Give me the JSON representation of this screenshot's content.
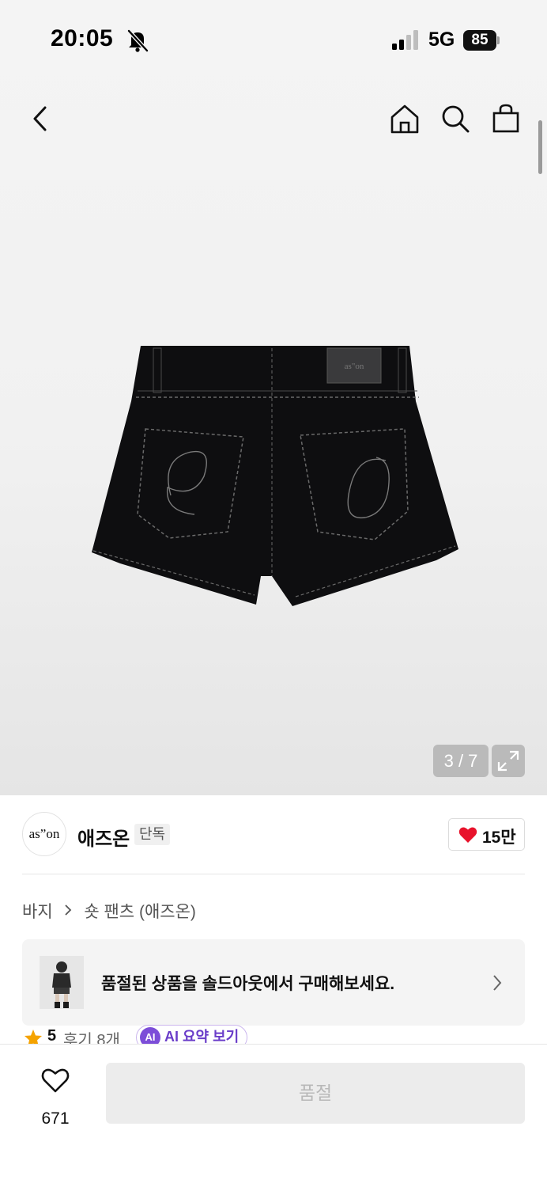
{
  "status_bar": {
    "time": "20:05",
    "network": "5G",
    "battery": "85",
    "icons": [
      "bell-slash-icon",
      "signal-bars-icon",
      "battery-icon"
    ]
  },
  "top_nav": {
    "icons": [
      "back-icon",
      "home-icon",
      "search-icon",
      "shopping-bag-icon"
    ]
  },
  "gallery": {
    "indicator": "3 / 7",
    "image": "black denim shorts, back view",
    "expand_icon": "expand-icon"
  },
  "brand": {
    "logo_text": "as”on",
    "name": "애즈온",
    "badge": "단독",
    "likes": "15만",
    "like_icon": "heart-fill-icon",
    "like_color": "#e8122b"
  },
  "breadcrumb": {
    "category": "바지",
    "subcategory": "숏 팬츠 (애즈온)"
  },
  "soldout_banner": {
    "text": "품절된 상품을 솔드아웃에서 구매해보세요."
  },
  "rating": {
    "value": "5",
    "reviews": "후기 8개",
    "ai_badge": "AI",
    "ai_label": "AI 요약 보기",
    "star_color": "#f5a300",
    "ai_color": "#7c4dd8"
  },
  "bottom_bar": {
    "wish_count": "671",
    "cta": "품절"
  }
}
